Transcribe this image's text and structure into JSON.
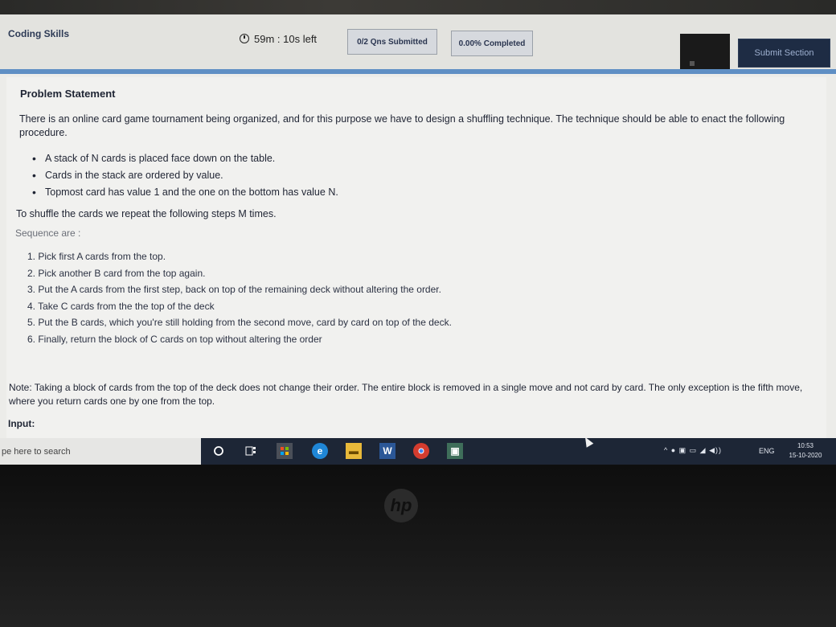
{
  "header": {
    "app_title": "Coding Skills",
    "timer": "59m : 10s  left",
    "questions_submitted": "0/2 Qns Submitted",
    "completed": "0.00% Completed",
    "submit_label": "Submit Section"
  },
  "problem": {
    "heading": "Problem Statement",
    "intro": "There is an online card game tournament being organized, and for this purpose we have to design a shuffling technique. The technique should be able to enact the following procedure.",
    "bullets": [
      "A stack of N cards is placed face down on the table.",
      "Cards in the stack are ordered by value.",
      "Topmost card has value 1 and the one on the bottom has value N."
    ],
    "repeat_text": "To shuffle the cards we repeat the following steps M times.",
    "sequence_label": "Sequence are :",
    "steps": [
      "1. Pick first A cards from the top.",
      "2. Pick another B card from the top again.",
      "3. Put the A cards from the first step, back on top of the remaining deck without altering the order.",
      "4. Take C cards from the the top of the deck",
      "5. Put the B cards, which you're still holding from the second move, card by card on top of the deck.",
      "6. Finally, return the block of C cards on top without altering the order"
    ],
    "note": "Note: Taking a block of cards from the top of the deck does not change their order. The entire block is removed in a single move and not card by card. The only exception is the fifth move, where you return cards one by one from the top.",
    "input_label": "Input:"
  },
  "taskbar": {
    "search_placeholder": "pe here to search",
    "lang": "ENG",
    "time": "10:53",
    "date": "15-10-2020",
    "icons": [
      "cortana-icon",
      "task-view-icon",
      "store-icon",
      "edge-icon",
      "file-explorer-icon",
      "word-icon",
      "chrome-icon",
      "app-icon"
    ]
  },
  "brand": "hp",
  "colors": {
    "accent": "#5f8fc4",
    "submit_bg": "#1e2c44",
    "taskbar": "#1d2636"
  }
}
